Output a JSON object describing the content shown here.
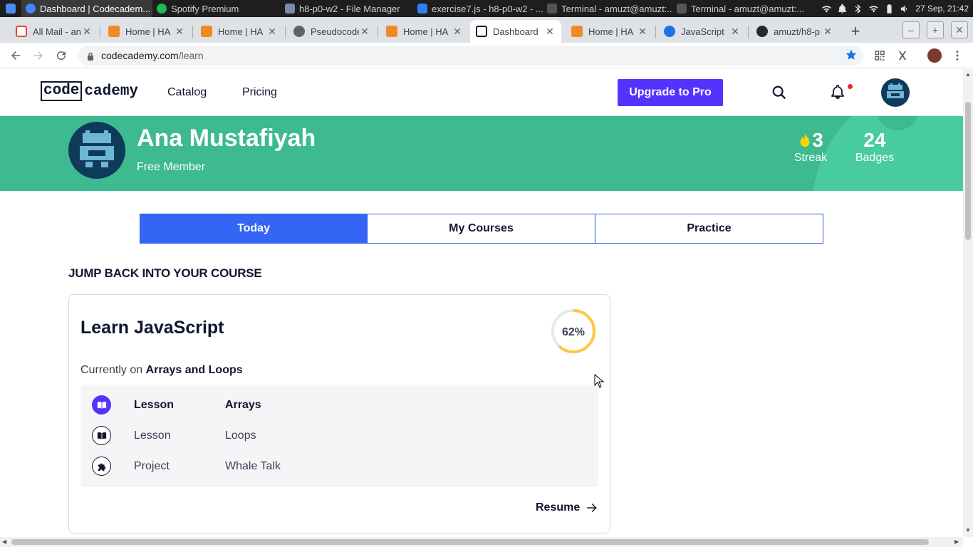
{
  "taskbar": {
    "windows": [
      {
        "label": "Dashboard | Codecadem...",
        "color": "#4285f4"
      },
      {
        "label": "Spotify Premium",
        "color": "#1db954"
      },
      {
        "label": "h8-p0-w2 - File Manager",
        "color": "#7a8ba8"
      },
      {
        "label": "exercise7.js - h8-p0-w2 - ...",
        "color": "#2f80ed"
      },
      {
        "label": "Terminal - amuzt@amuzt:...",
        "color": "#444"
      },
      {
        "label": "Terminal - amuzt@amuzt:...",
        "color": "#444"
      }
    ],
    "clock": "27 Sep, 21:42"
  },
  "tabs": [
    {
      "title": "All Mail - an",
      "icon": "gmail-icon",
      "color": "#ea4335"
    },
    {
      "title": "Home | HA",
      "icon": "hacktiv8-icon",
      "color": "#f08a24"
    },
    {
      "title": "Home | HA",
      "icon": "hacktiv8-icon",
      "color": "#f08a24"
    },
    {
      "title": "Pseudocode",
      "icon": "globe-icon",
      "color": "#5f6368"
    },
    {
      "title": "Home | HA",
      "icon": "hacktiv8-icon",
      "color": "#f08a24"
    },
    {
      "title": "Dashboard",
      "icon": "codecademy-icon",
      "color": "#10162f"
    },
    {
      "title": "Home | HA",
      "icon": "hacktiv8-icon",
      "color": "#f08a24"
    },
    {
      "title": "JavaScript",
      "icon": "mdn-icon",
      "color": "#1b73e8"
    },
    {
      "title": "amuzt/h8-p",
      "icon": "github-icon",
      "color": "#24292e"
    }
  ],
  "address": {
    "host": "codecademy.com",
    "path": "/learn"
  },
  "header": {
    "logo_left": "code",
    "logo_right": "cademy",
    "nav": [
      "Catalog",
      "Pricing"
    ],
    "upgrade_label": "Upgrade to Pro"
  },
  "profile": {
    "name": "Ana Mustafiyah",
    "membership": "Free Member",
    "streak_value": "3",
    "streak_label": "Streak",
    "badges_value": "24",
    "badges_label": "Badges"
  },
  "segment_tabs": [
    "Today",
    "My Courses",
    "Practice"
  ],
  "course": {
    "section_heading": "JUMP BACK INTO YOUR COURSE",
    "title": "Learn JavaScript",
    "progress_label": "62%",
    "progress": 0.62,
    "current_prefix": "Currently on",
    "current_topic": "Arrays and Loops",
    "items": [
      {
        "kind": "Lesson",
        "name": "Arrays",
        "icon": "book-icon",
        "current": true
      },
      {
        "kind": "Lesson",
        "name": "Loops",
        "icon": "book-icon",
        "current": false
      },
      {
        "kind": "Project",
        "name": "Whale Talk",
        "icon": "puzzle-icon",
        "current": false
      }
    ],
    "resume_label": "Resume"
  },
  "colors": {
    "hero_green": "#3dba8f",
    "brand_purple": "#5533ff",
    "tab_blue": "#3465f5",
    "progress_yellow": "#ffc740"
  }
}
